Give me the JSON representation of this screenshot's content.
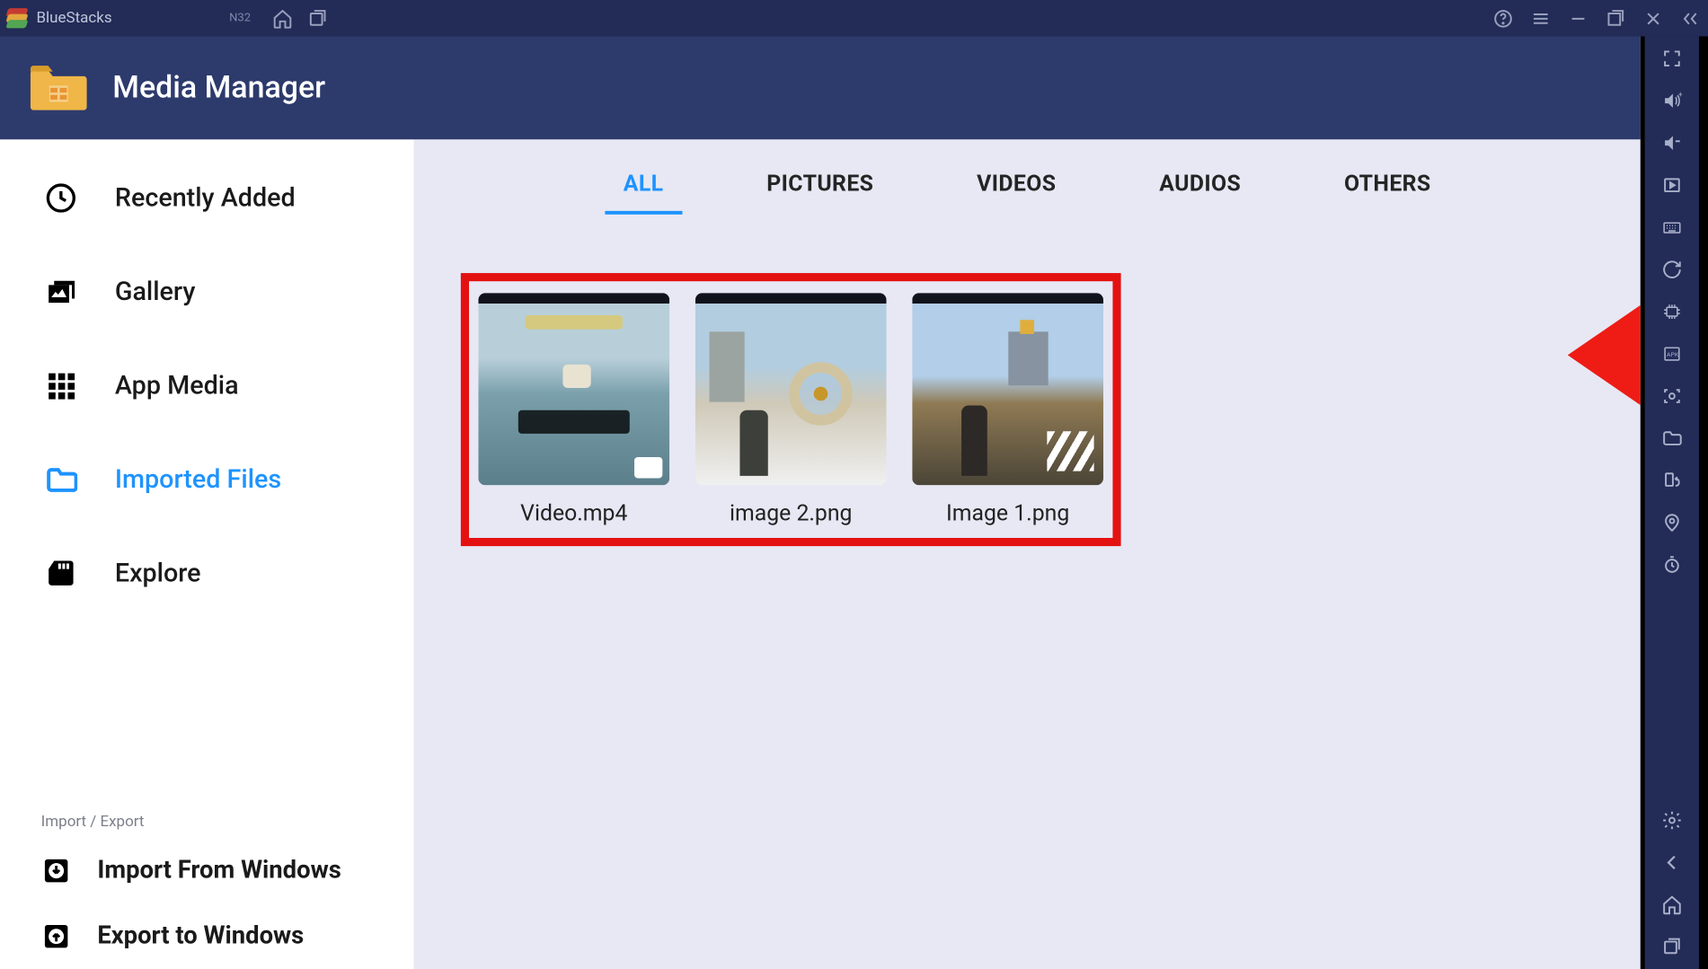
{
  "titlebar": {
    "app_name": "BlueStacks",
    "badge": "N32"
  },
  "header": {
    "title": "Media Manager"
  },
  "sidebar": {
    "items": [
      {
        "label": "Recently Added"
      },
      {
        "label": "Gallery"
      },
      {
        "label": "App Media"
      },
      {
        "label": "Imported Files"
      },
      {
        "label": "Explore"
      }
    ],
    "section_label": "Import / Export",
    "actions": [
      {
        "label": "Import From Windows"
      },
      {
        "label": "Export to Windows"
      }
    ]
  },
  "tabs": [
    "ALL",
    "PICTURES",
    "VIDEOS",
    "AUDIOS",
    "OTHERS"
  ],
  "files": [
    {
      "name": "Video.mp4"
    },
    {
      "name": "image 2.png"
    },
    {
      "name": "Image 1.png"
    }
  ]
}
